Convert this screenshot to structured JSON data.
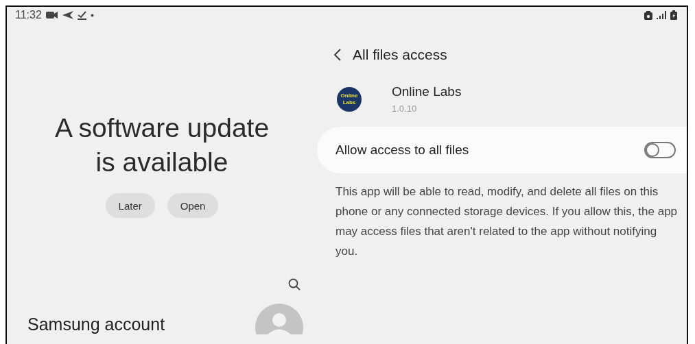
{
  "status_bar": {
    "time": "11:32"
  },
  "left_panel": {
    "update_title": "A software update is available",
    "buttons": [
      {
        "label": "Later"
      },
      {
        "label": "Open"
      }
    ],
    "account_title": "Samsung account"
  },
  "right_panel": {
    "title": "All files access",
    "app": {
      "name": "Online Labs",
      "version": "1.0.10",
      "icon_text": "Online Labs"
    },
    "setting": {
      "label": "Allow access to all files",
      "on": false
    },
    "description": "This app will be able to read, modify, and delete all files on this phone or any connected storage devices. If you allow this, the app may access files that aren't related to the app without notifying you."
  }
}
